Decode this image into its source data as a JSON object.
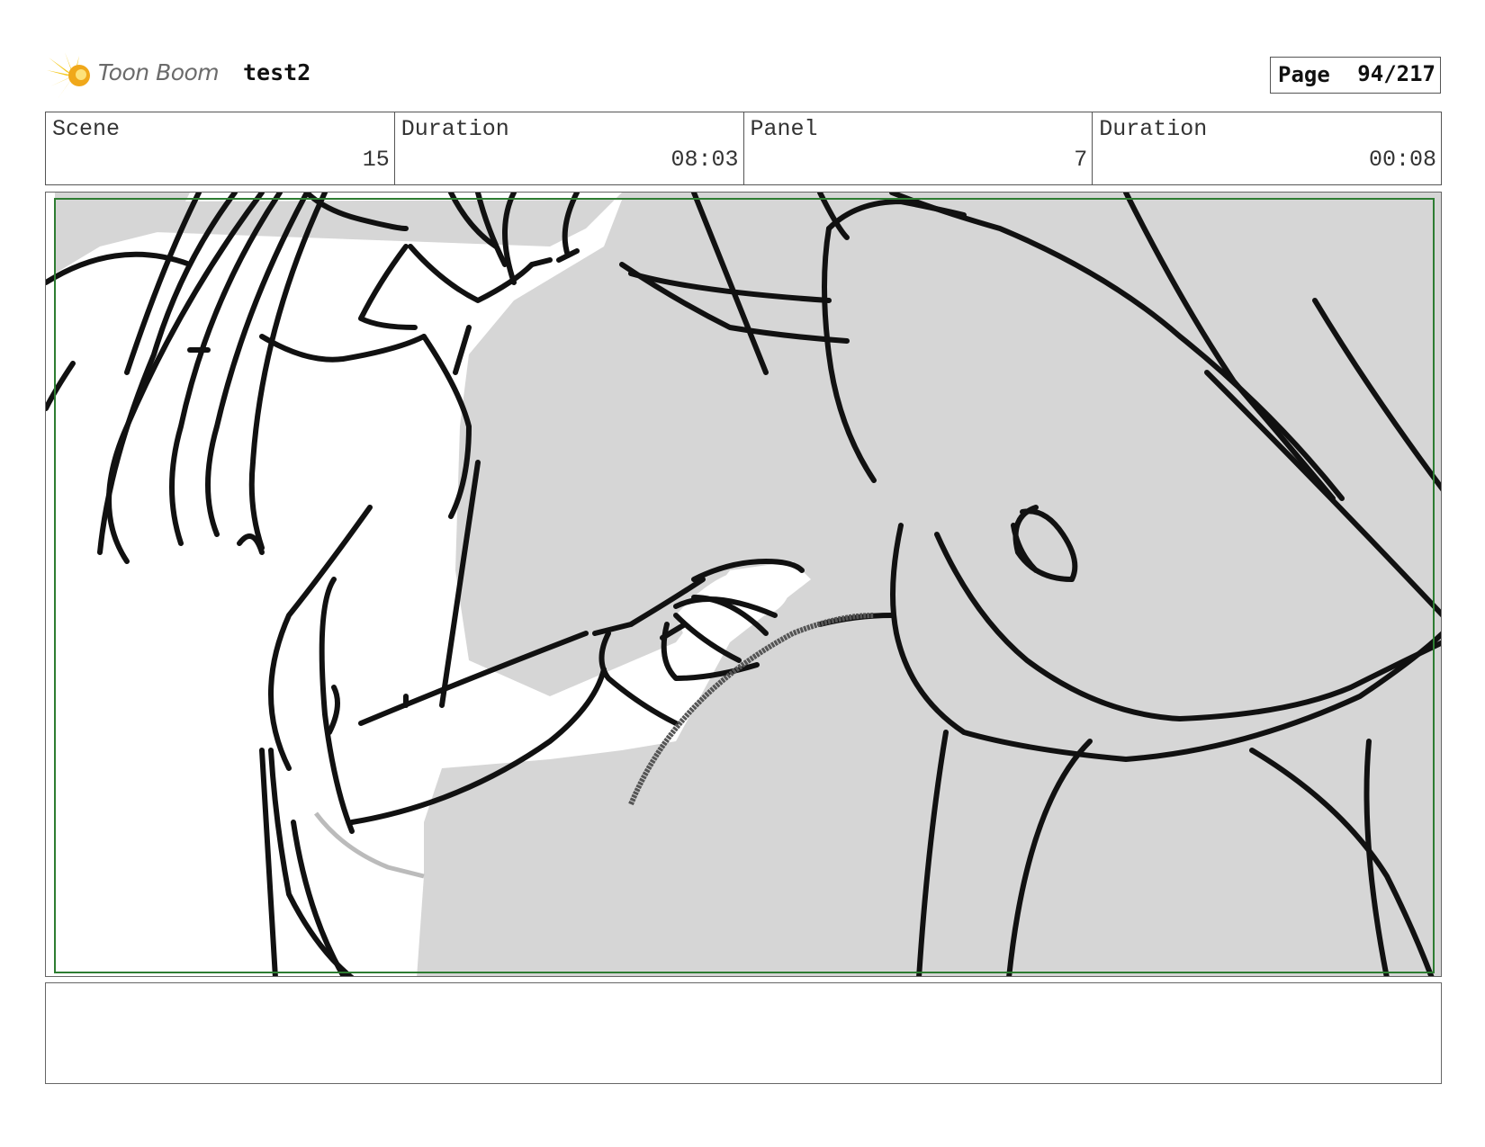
{
  "header": {
    "logo_text": "Toon Boom",
    "project_name": "test2",
    "page_label": "Page",
    "page_value": "94/217"
  },
  "info": {
    "scene_label": "Scene",
    "scene_value": "15",
    "scene_duration_label": "Duration",
    "scene_duration_value": "08:03",
    "panel_label": "Panel",
    "panel_value": "7",
    "panel_duration_label": "Duration",
    "panel_duration_value": "00:08"
  },
  "panel": {
    "safe_frame_color": "#2e7d32",
    "fill_color": "#d6d6d6",
    "line_color": "#111111"
  },
  "notes": {
    "text": ""
  },
  "icons": {
    "logo": "toon-boom-starburst-icon"
  }
}
